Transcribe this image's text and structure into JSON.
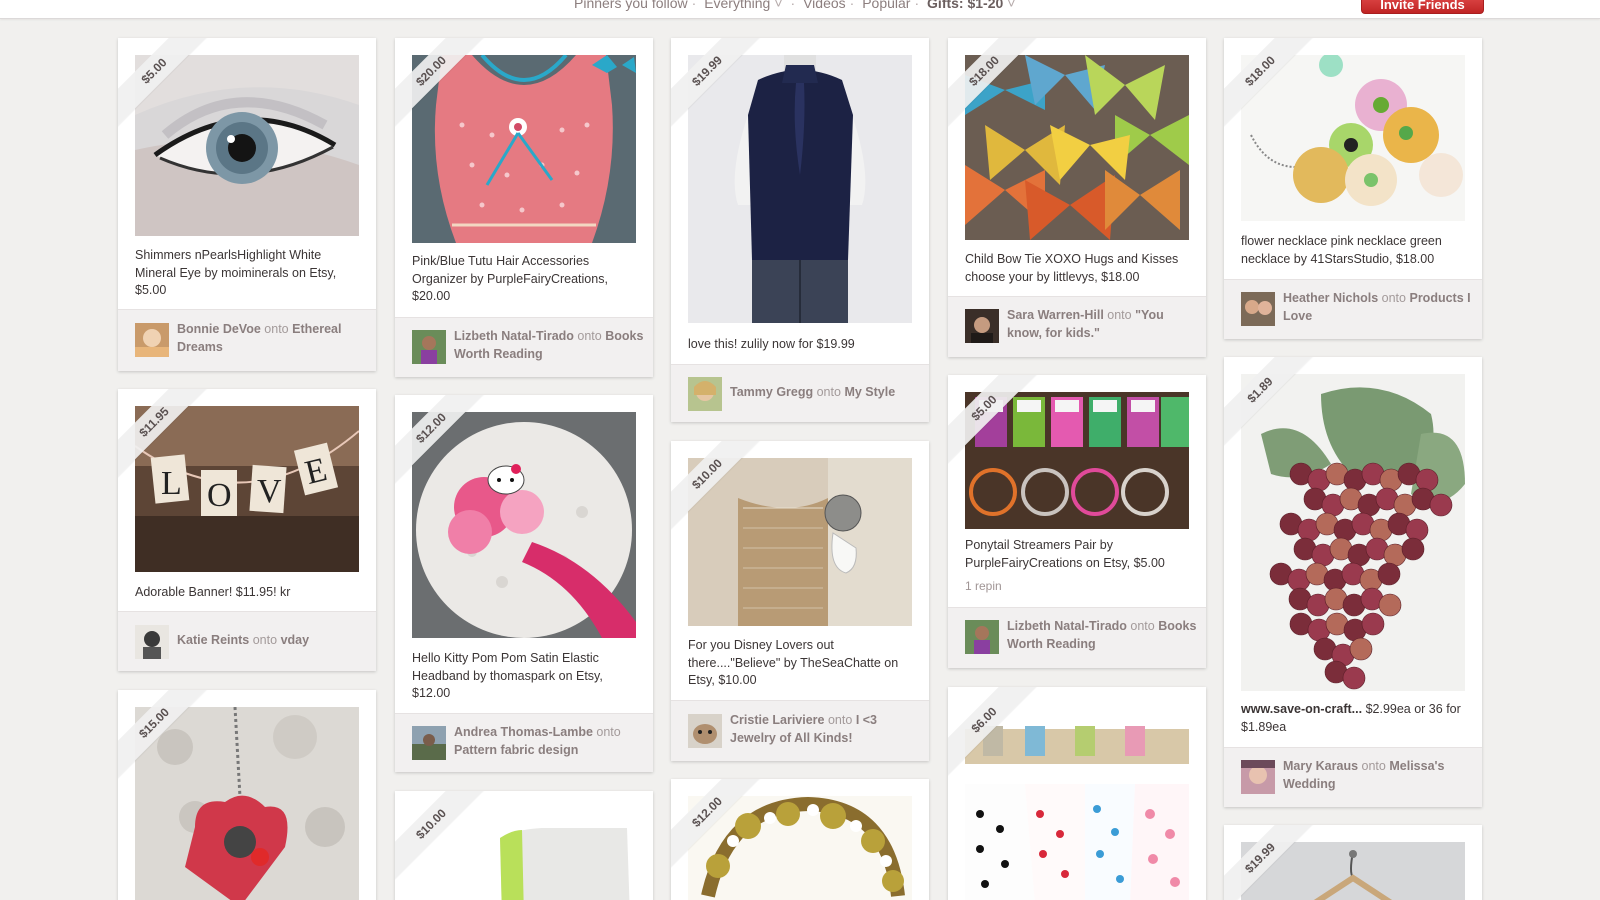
{
  "nav": {
    "items": [
      "Pinners you follow",
      "Everything",
      "Videos",
      "Popular",
      "Gifts: $1-20"
    ],
    "active": "Gifts: $1-20",
    "invite_label": "Invite Friends"
  },
  "colors": {
    "accent": "#cb2027",
    "background": "#f1f0ee"
  },
  "pins": [
    {
      "price": "$5.00",
      "desc": "Shimmers nPearlsHighlight White Mineral Eye by moiminerals on Etsy, $5.00",
      "user": "Bonnie DeVoe",
      "board": "Ethereal Dreams",
      "image": "eye-makeup"
    },
    {
      "price": "$20.00",
      "desc": "Pink/Blue Tutu Hair Accessories Organizer by PurpleFairyCreations, $20.00",
      "user": "Lizbeth Natal-Tirado",
      "board": "Books Worth Reading",
      "image": "tutu-organizer"
    },
    {
      "price": "$19.99",
      "desc": "love this! zulily now for $19.99",
      "user": "Tammy Gregg",
      "board": "My Style",
      "image": "navy-blouse"
    },
    {
      "price": "$18.00",
      "desc": "Child Bow Tie XOXO Hugs and Kisses choose your by littlevys, $18.00",
      "user": "Sara Warren-Hill",
      "board": "\"You know, for kids.\"",
      "image": "bow-ties"
    },
    {
      "price": "$18.00",
      "desc": "flower necklace pink necklace green necklace by 41StarsStudio, $18.00",
      "user": "Heather Nichols",
      "board": "Products I Love",
      "image": "flower-necklace"
    },
    {
      "price": "$11.95",
      "desc": "Adorable Banner! $11.95! kr",
      "user": "Katie Reints",
      "board": "vday",
      "image": "love-banner"
    },
    {
      "price": "$12.00",
      "desc": "Hello Kitty Pom Pom Satin Elastic Headband by thomaspark on Etsy, $12.00",
      "user": "Andrea Thomas-Lambe",
      "board": "Pattern fabric design",
      "image": "kitty-headband"
    },
    {
      "price": "$10.00",
      "desc": "For you Disney Lovers out there....\"Believe\" by TheSeaChatte on Etsy, $10.00",
      "user": "Cristie Lariviere",
      "board": "I <3 Jewelry of All Kinds!",
      "image": "disney-bookmark"
    },
    {
      "price": "$5.00",
      "desc": "Ponytail Streamers Pair by PurpleFairyCreations on Etsy, $5.00",
      "repin": "1 repin",
      "user": "Lizbeth Natal-Tirado",
      "board": "Books Worth Reading",
      "image": "ponytail-streamers"
    },
    {
      "price": "$1.89",
      "desc_bold": "www.save-on-craft...",
      "desc": " $2.99ea or 36 for $1.89ea",
      "user": "Mary Karaus",
      "board": "Melissa's Wedding",
      "image": "grapes"
    },
    {
      "price": "$15.00",
      "image": "heart-pendant"
    },
    {
      "price": "$10.00",
      "image": "green-device"
    },
    {
      "price": "$12.00",
      "image": "bracelet"
    },
    {
      "price": "$6.00",
      "image": "polka-dot-fabric"
    },
    {
      "price": "$19.99",
      "image": "hanger"
    }
  ],
  "onto_word": "onto"
}
